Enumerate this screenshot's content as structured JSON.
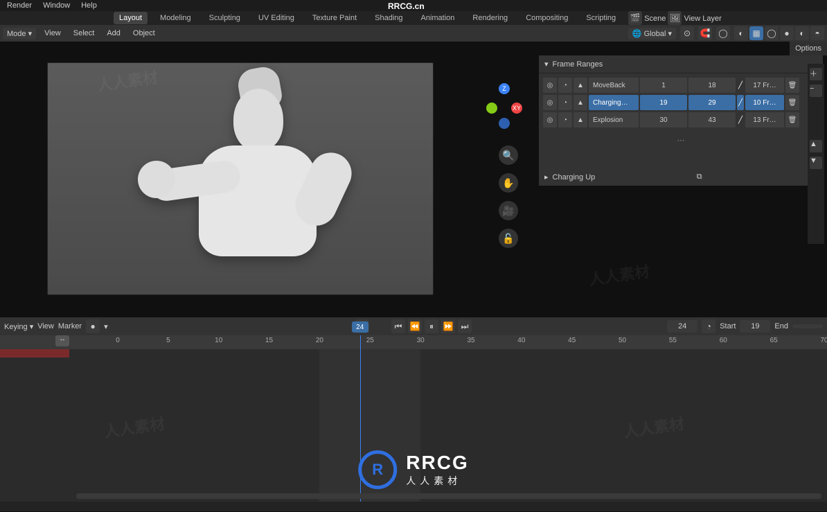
{
  "site": "RRCG.cn",
  "menubar": {
    "items": [
      "Render",
      "Window",
      "Help"
    ]
  },
  "tabbar": {
    "tabs": [
      "Layout",
      "Modeling",
      "Sculpting",
      "UV Editing",
      "Texture Paint",
      "Shading",
      "Animation",
      "Rendering",
      "Compositing",
      "Scripting"
    ],
    "active": "Layout"
  },
  "header_right": {
    "scene_label": "Scene",
    "viewlayer_label": "View Layer"
  },
  "toolbar": {
    "mode": "Mode",
    "menus": [
      "View",
      "Select",
      "Add",
      "Object"
    ],
    "orientation": "Global"
  },
  "options_label": "Options",
  "viewport_gizmo": {
    "z": "Z",
    "xy": "XY"
  },
  "vtools": [
    "🔍",
    "✋",
    "🎥",
    "🔓"
  ],
  "panel": {
    "title": "Frame Ranges",
    "ranges": [
      {
        "name": "MoveBack",
        "start": 1,
        "end": 18,
        "dur": "17 Fr…"
      },
      {
        "name": "Charging…",
        "start": 19,
        "end": 29,
        "dur": "10 Fr…"
      },
      {
        "name": "Explosion",
        "start": 30,
        "end": 43,
        "dur": "13 Fr…"
      }
    ],
    "active_index": 1,
    "sub_title": "Charging Up"
  },
  "timeline": {
    "menus": [
      "Keying",
      "View",
      "Marker"
    ],
    "current": 24,
    "start_label": "Start",
    "start": 19,
    "end_label": "End",
    "end_value": "",
    "ticks": [
      0,
      5,
      10,
      15,
      20,
      25,
      30,
      35,
      40,
      45,
      50,
      55,
      60,
      65,
      70
    ],
    "playhead": 24,
    "range_a": {
      "from": 0,
      "to": 100
    },
    "zone": {
      "from": 20,
      "to": 30
    }
  },
  "watermark": {
    "big": "RRCG",
    "small": "人人素材"
  }
}
